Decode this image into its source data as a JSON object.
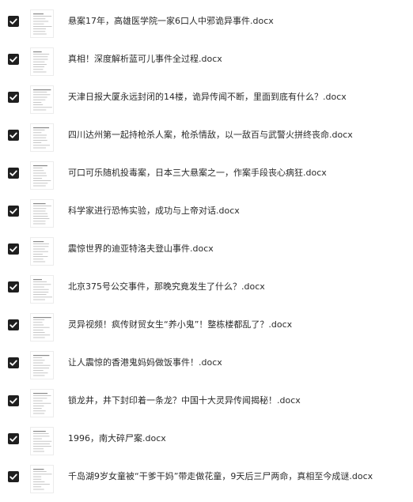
{
  "files": [
    {
      "name": "悬案17年，高雄医学院一家6口人中邪诡异事件.docx",
      "checked": true
    },
    {
      "name": "真相！深度解析蓝可儿事件全过程.docx",
      "checked": true
    },
    {
      "name": "天津日报大厦永远封闭的14楼，诡异传闻不断，里面到底有什么？.docx",
      "checked": true
    },
    {
      "name": "四川达州第一起持枪杀人案，枪杀情敌，以一敌百与武警火拼终丧命.docx",
      "checked": true
    },
    {
      "name": "可口可乐随机投毒案，日本三大悬案之一，作案手段丧心病狂.docx",
      "checked": true
    },
    {
      "name": "科学家进行恐怖实验，成功与上帝对话.docx",
      "checked": true
    },
    {
      "name": "震惊世界的迪亚特洛夫登山事件.docx",
      "checked": true
    },
    {
      "name": "北京375号公交事件，那晚究竟发生了什么？.docx",
      "checked": true
    },
    {
      "name": "灵异视频！疯传财贸女生“养小鬼”！整栋楼都乱了？.docx",
      "checked": true
    },
    {
      "name": "让人震惊的香港鬼妈妈做饭事件！.docx",
      "checked": true
    },
    {
      "name": "锁龙井，井下封印着一条龙？中国十大灵异传闻揭秘！.docx",
      "checked": true
    },
    {
      "name": "1996，南大碎尸案.docx",
      "checked": true
    },
    {
      "name": "千岛湖9岁女童被“干爹干妈”带走做花童，9天后三尸两命，真相至今成谜.docx",
      "checked": true
    }
  ],
  "colors": {
    "checkbox": "#1f1f1f",
    "text": "#2b2b2b"
  },
  "icons": {
    "checkbox": "checkbox-checked-icon",
    "thumbnail": "document-thumbnail"
  }
}
